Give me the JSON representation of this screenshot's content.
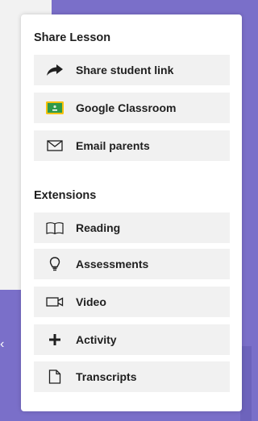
{
  "share": {
    "title": "Share Lesson",
    "items": [
      {
        "label": "Share student link",
        "icon": "share-arrow-icon"
      },
      {
        "label": "Google Classroom",
        "icon": "google-classroom-icon"
      },
      {
        "label": "Email parents",
        "icon": "envelope-icon"
      }
    ]
  },
  "extensions": {
    "title": "Extensions",
    "items": [
      {
        "label": "Reading",
        "icon": "book-icon"
      },
      {
        "label": "Assessments",
        "icon": "lightbulb-icon"
      },
      {
        "label": "Video",
        "icon": "video-camera-icon"
      },
      {
        "label": "Activity",
        "icon": "plus-icon"
      },
      {
        "label": "Transcripts",
        "icon": "document-icon"
      }
    ]
  },
  "colors": {
    "background_accent": "#7a6fc9",
    "panel": "#ffffff",
    "item_background": "#f1f1f1",
    "classroom_green": "#2e9a4a",
    "classroom_yellow": "#f4c20d"
  }
}
